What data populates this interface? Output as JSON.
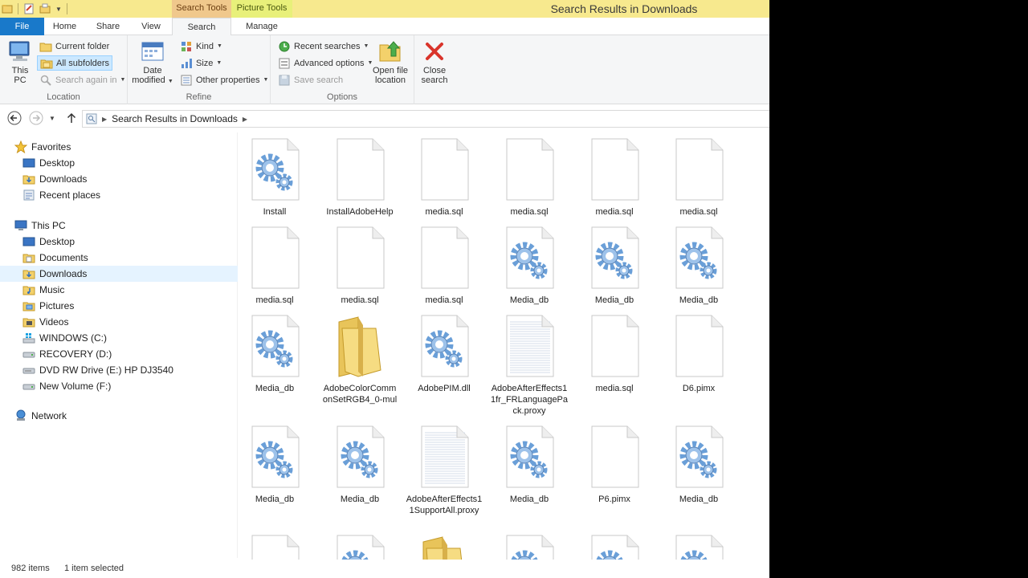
{
  "window": {
    "title": "Search Results in Downloads"
  },
  "context_tabs": {
    "search_tools": "Search Tools",
    "picture_tools": "Picture Tools"
  },
  "tabs": {
    "file": "File",
    "home": "Home",
    "share": "Share",
    "view": "View",
    "search": "Search",
    "manage": "Manage"
  },
  "ribbon": {
    "location": {
      "label": "Location",
      "this_pc": [
        "This",
        "PC"
      ],
      "current_folder": "Current folder",
      "all_subfolders": "All subfolders",
      "search_again_in": "Search again in"
    },
    "refine": {
      "label": "Refine",
      "date_modified": [
        "Date",
        "modified"
      ],
      "kind": "Kind",
      "size": "Size",
      "other_properties": "Other properties"
    },
    "options": {
      "label": "Options",
      "recent_searches": "Recent searches",
      "advanced_options": "Advanced options",
      "save_search": "Save search",
      "open_file_location": [
        "Open file",
        "location"
      ],
      "close_search": [
        "Close",
        "search"
      ]
    }
  },
  "address": {
    "path": "Search Results in Downloads"
  },
  "nav": {
    "favorites": {
      "label": "Favorites",
      "items": [
        "Desktop",
        "Downloads",
        "Recent places"
      ]
    },
    "this_pc": {
      "label": "This PC",
      "items": [
        "Desktop",
        "Documents",
        "Downloads",
        "Music",
        "Pictures",
        "Videos",
        "WINDOWS (C:)",
        "RECOVERY (D:)",
        "DVD RW Drive (E:) HP DJ3540",
        "New Volume (F:)"
      ]
    },
    "network": {
      "label": "Network"
    }
  },
  "files": [
    {
      "name": "Install",
      "icon": "gear"
    },
    {
      "name": "InstallAdobeHelp",
      "icon": "blank"
    },
    {
      "name": "media.sql",
      "icon": "blank"
    },
    {
      "name": "media.sql",
      "icon": "blank"
    },
    {
      "name": "media.sql",
      "icon": "blank"
    },
    {
      "name": "media.sql",
      "icon": "blank"
    },
    {
      "name": "media.sql",
      "icon": "blank"
    },
    {
      "name": "media.sql",
      "icon": "blank"
    },
    {
      "name": "media.sql",
      "icon": "blank"
    },
    {
      "name": "Media_db",
      "icon": "gear"
    },
    {
      "name": "Media_db",
      "icon": "gear"
    },
    {
      "name": "Media_db",
      "icon": "gear"
    },
    {
      "name": "Media_db",
      "icon": "gear"
    },
    {
      "name": "AdobeColorCommonSetRGB4_0-mul",
      "icon": "folder"
    },
    {
      "name": "AdobePIM.dll",
      "icon": "gear"
    },
    {
      "name": "AdobeAfterEffects11fr_FRLanguagePack.proxy",
      "icon": "lined"
    },
    {
      "name": "media.sql",
      "icon": "blank"
    },
    {
      "name": "D6.pimx",
      "icon": "blank"
    },
    {
      "name": "Media_db",
      "icon": "gear"
    },
    {
      "name": "Media_db",
      "icon": "gear"
    },
    {
      "name": "AdobeAfterEffects11SupportAll.proxy",
      "icon": "lined"
    },
    {
      "name": "Media_db",
      "icon": "gear"
    },
    {
      "name": "P6.pimx",
      "icon": "blank"
    },
    {
      "name": "Media_db",
      "icon": "gear"
    },
    {
      "name": "",
      "icon": "blank"
    },
    {
      "name": "",
      "icon": "gear"
    },
    {
      "name": "",
      "icon": "folder"
    },
    {
      "name": "",
      "icon": "gear"
    },
    {
      "name": "",
      "icon": "gear"
    },
    {
      "name": "",
      "icon": "gear"
    }
  ],
  "status": {
    "count": "982 items",
    "selected": "1 item selected"
  },
  "colors": {
    "title_bg": "#f7e98e",
    "file_tab": "#1979ca",
    "selection": "#cce8ff"
  }
}
